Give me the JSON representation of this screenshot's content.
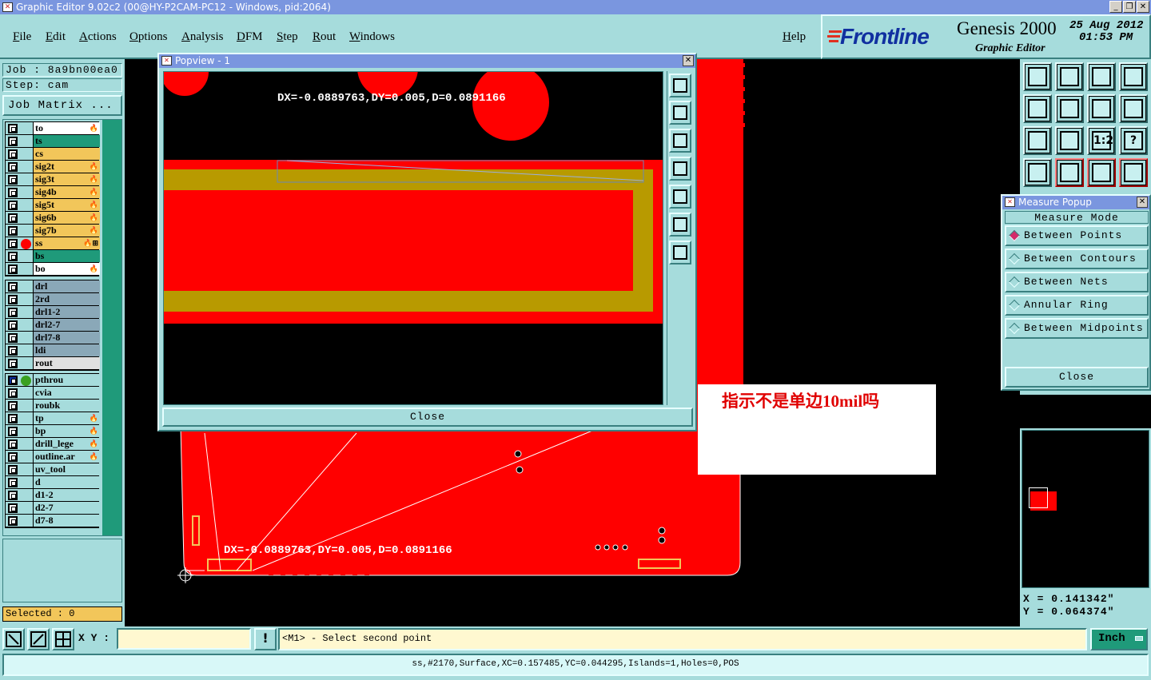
{
  "window": {
    "title": "Graphic Editor 9.02c2 (00@HY-P2CAM-PC12 - Windows, pid:2064)",
    "buttons": [
      "_",
      "❐",
      "✕"
    ]
  },
  "menu": {
    "items": [
      "File",
      "Edit",
      "Actions",
      "Options",
      "Analysis",
      "DFM",
      "Step",
      "Rout",
      "Windows"
    ],
    "help": "Help"
  },
  "brand": {
    "logo": "Frontline",
    "product": "Genesis 2000",
    "subtitle": "Graphic Editor",
    "date": "25 Aug 2012",
    "time": "01:53 PM"
  },
  "job": {
    "job_label": "Job : 8a9bn00ea0",
    "step_label": "Step: cam",
    "matrix_button": "Job Matrix ..."
  },
  "layers_board": [
    {
      "name": "to",
      "color": "#ffffff",
      "flag": "🔥"
    },
    {
      "name": "ts",
      "color": "#1f9a7a",
      "flag": ""
    },
    {
      "name": "cs",
      "color": "#f2c65a",
      "flag": ""
    },
    {
      "name": "sig2t",
      "color": "#f2c65a",
      "flag": "🔥"
    },
    {
      "name": "sig3t",
      "color": "#f2c65a",
      "flag": "🔥"
    },
    {
      "name": "sig4b",
      "color": "#f2c65a",
      "flag": "🔥"
    },
    {
      "name": "sig5t",
      "color": "#f2c65a",
      "flag": "🔥"
    },
    {
      "name": "sig6b",
      "color": "#f2c65a",
      "flag": "🔥"
    },
    {
      "name": "sig7b",
      "color": "#f2c65a",
      "flag": "🔥"
    },
    {
      "name": "ss",
      "color": "#f2c65a",
      "flag": "🔥⊞",
      "dot": "#ff0000"
    },
    {
      "name": "bs",
      "color": "#1f9a7a",
      "flag": ""
    },
    {
      "name": "bo",
      "color": "#ffffff",
      "flag": "🔥"
    }
  ],
  "layers_drill": [
    {
      "name": "drl",
      "color": "#8aa8b8"
    },
    {
      "name": "2rd",
      "color": "#8aa8b8"
    },
    {
      "name": "drl1-2",
      "color": "#8aa8b8"
    },
    {
      "name": "drl2-7",
      "color": "#8aa8b8"
    },
    {
      "name": "drl7-8",
      "color": "#8aa8b8"
    },
    {
      "name": "ldi",
      "color": "#8aa8b8"
    },
    {
      "name": "rout",
      "color": "#e0e0e0"
    }
  ],
  "layers_misc": [
    {
      "name": "pthrou",
      "color": "#a6dcdc",
      "flag": "",
      "dot": "#3aa020",
      "checked": true
    },
    {
      "name": "cvia",
      "color": "#a6dcdc",
      "flag": ""
    },
    {
      "name": "roubk",
      "color": "#a6dcdc",
      "flag": ""
    },
    {
      "name": "tp",
      "color": "#a6dcdc",
      "flag": "🔥"
    },
    {
      "name": "bp",
      "color": "#a6dcdc",
      "flag": "🔥"
    },
    {
      "name": "drill_lege",
      "color": "#a6dcdc",
      "flag": "🔥"
    },
    {
      "name": "outline.ar",
      "color": "#a6dcdc",
      "flag": "🔥"
    },
    {
      "name": "uv_tool",
      "color": "#a6dcdc",
      "flag": ""
    },
    {
      "name": "d",
      "color": "#a6dcdc",
      "flag": ""
    },
    {
      "name": "d1-2",
      "color": "#a6dcdc",
      "flag": ""
    },
    {
      "name": "d2-7",
      "color": "#a6dcdc",
      "flag": ""
    },
    {
      "name": "d7-8",
      "color": "#a6dcdc",
      "flag": ""
    }
  ],
  "selected_label": "Selected : 0",
  "popview": {
    "title": "Popview - 1",
    "measure_text": "DX=-0.0889763,DY=0.005,D=0.0891166",
    "close_label": "Close"
  },
  "canvas": {
    "measure_text": "DX=-0.0889763,DY=0.005,D=0.0891166"
  },
  "annotation": {
    "text": "指示不是单边10mil吗"
  },
  "measure_popup": {
    "title": "Measure Popup",
    "heading": "Measure Mode",
    "options": [
      "Between Points",
      "Between Contours",
      "Between Nets",
      "Annular Ring",
      "Between Midpoints"
    ],
    "selected": "Between Points",
    "close_label": "Close"
  },
  "toolbar_icons": [
    "zoom-home-icon",
    "zoom-fit-icon",
    "house-icon",
    "split-view-icon",
    "pan-left-icon",
    "pan-right-icon",
    "mirror-icon",
    "snap-icon",
    "fit-screen-icon",
    "center-icon",
    "one-to-two-icon",
    "help-query-icon",
    "measure-tools-icon",
    "net-probe-icon",
    "layer-color-icon",
    "layer-toggle-icon"
  ],
  "toolbar_labels": {
    "one_to_two": "1:2",
    "help_query": "?"
  },
  "coords": {
    "x": "X = 0.141342\"",
    "y": "Y = 0.064374\""
  },
  "bottom": {
    "xy_label": "X Y :",
    "xy_value": "",
    "exclaim": "!",
    "prompt": "<M1> - Select second point",
    "units": "Inch",
    "status": "ss,#2170,Surface,XC=0.157485,YC=0.044295,Islands=1,Holes=0,POS"
  }
}
